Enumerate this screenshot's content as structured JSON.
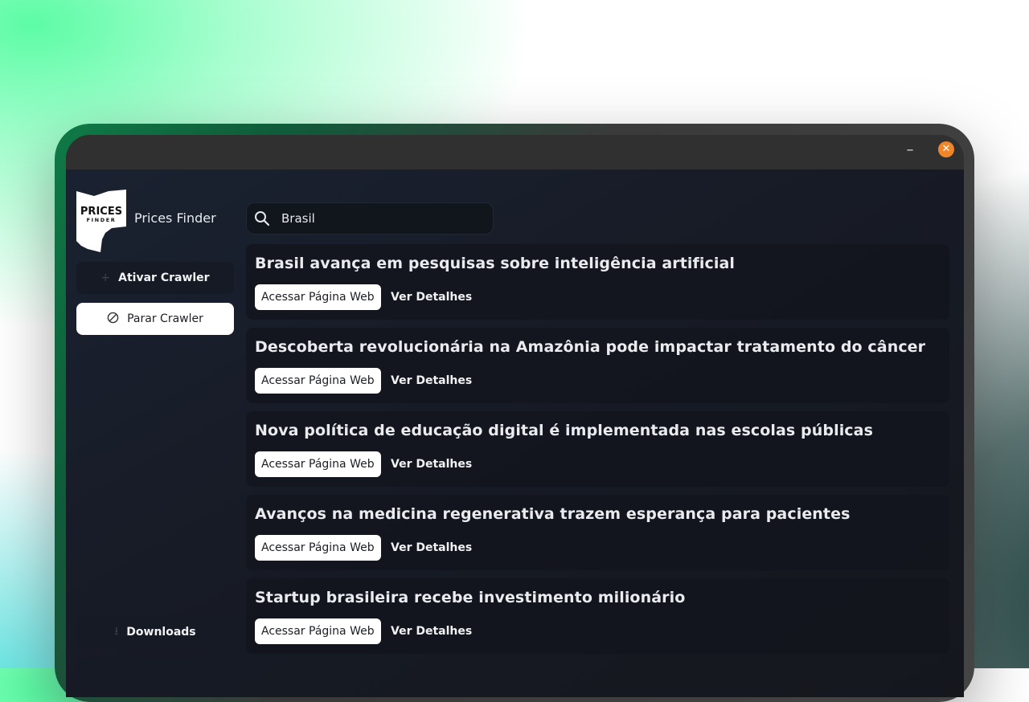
{
  "app": {
    "name": "Prices Finder",
    "logo_text_top": "PRICES",
    "logo_text_bottom": "FINDER"
  },
  "window_controls": {
    "minimize": "–",
    "close": "✕"
  },
  "sidebar": {
    "activate_label": "Ativar Crawler",
    "stop_label": "Parar Crawler",
    "downloads_label": "Downloads"
  },
  "search": {
    "value": "Brasil",
    "icon": "search-icon"
  },
  "results": [
    {
      "title": "Brasil avança em pesquisas sobre inteligência artificial",
      "web_label": "Acessar Página Web",
      "details_label": "Ver Detalhes"
    },
    {
      "title": "Descoberta revolucionária na Amazônia pode impactar tratamento do câncer",
      "web_label": "Acessar Página Web",
      "details_label": "Ver Detalhes"
    },
    {
      "title": "Nova política de educação digital é implementada nas escolas públicas",
      "web_label": "Acessar Página Web",
      "details_label": "Ver Detalhes"
    },
    {
      "title": "Avanços na medicina regenerativa trazem esperança para pacientes",
      "web_label": "Acessar Página Web",
      "details_label": "Ver Detalhes"
    },
    {
      "title": "Startup brasileira recebe investimento milionário",
      "web_label": "Acessar Página Web",
      "details_label": "Ver Detalhes"
    }
  ],
  "colors": {
    "accent_close": "#f0862a",
    "background": "#171b26",
    "card": "#12151c"
  }
}
